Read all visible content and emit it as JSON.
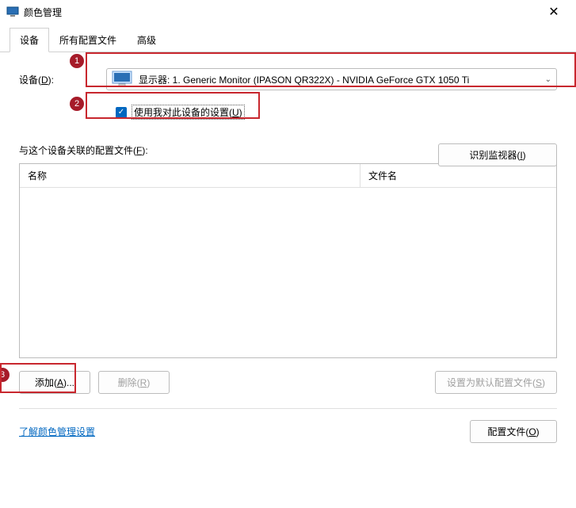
{
  "window": {
    "title": "颜色管理",
    "close_glyph": "✕"
  },
  "tabs": [
    {
      "label": "设备"
    },
    {
      "label": "所有配置文件"
    },
    {
      "label": "高级"
    }
  ],
  "device": {
    "label_prefix": "设备(",
    "label_u": "D",
    "label_suffix": "):",
    "selected": "显示器: 1. Generic Monitor (IPASON QR322X) - NVIDIA GeForce GTX 1050 Ti"
  },
  "checkbox": {
    "checked": true,
    "label_prefix": "使用我对此设备的设置(",
    "label_u": "U",
    "label_suffix": ")"
  },
  "identify_btn": {
    "label_prefix": "识别监视器(",
    "label_u": "I",
    "label_suffix": ")"
  },
  "assoc_label": {
    "prefix": "与这个设备关联的配置文件(",
    "u": "F",
    "suffix": "):"
  },
  "columns": {
    "name": "名称",
    "file": "文件名"
  },
  "buttons": {
    "add_prefix": "添加(",
    "add_u": "A",
    "add_suffix": ")...",
    "remove_prefix": "删除(",
    "remove_u": "R",
    "remove_suffix": ")",
    "set_default_prefix": "设置为默认配置文件(",
    "set_default_u": "S",
    "set_default_suffix": ")",
    "profiles_prefix": "配置文件(",
    "profiles_u": "O",
    "profiles_suffix": ")"
  },
  "link": {
    "text": "了解颜色管理设置"
  },
  "annotations": {
    "b1": "1",
    "b2": "2",
    "b3": "3"
  }
}
